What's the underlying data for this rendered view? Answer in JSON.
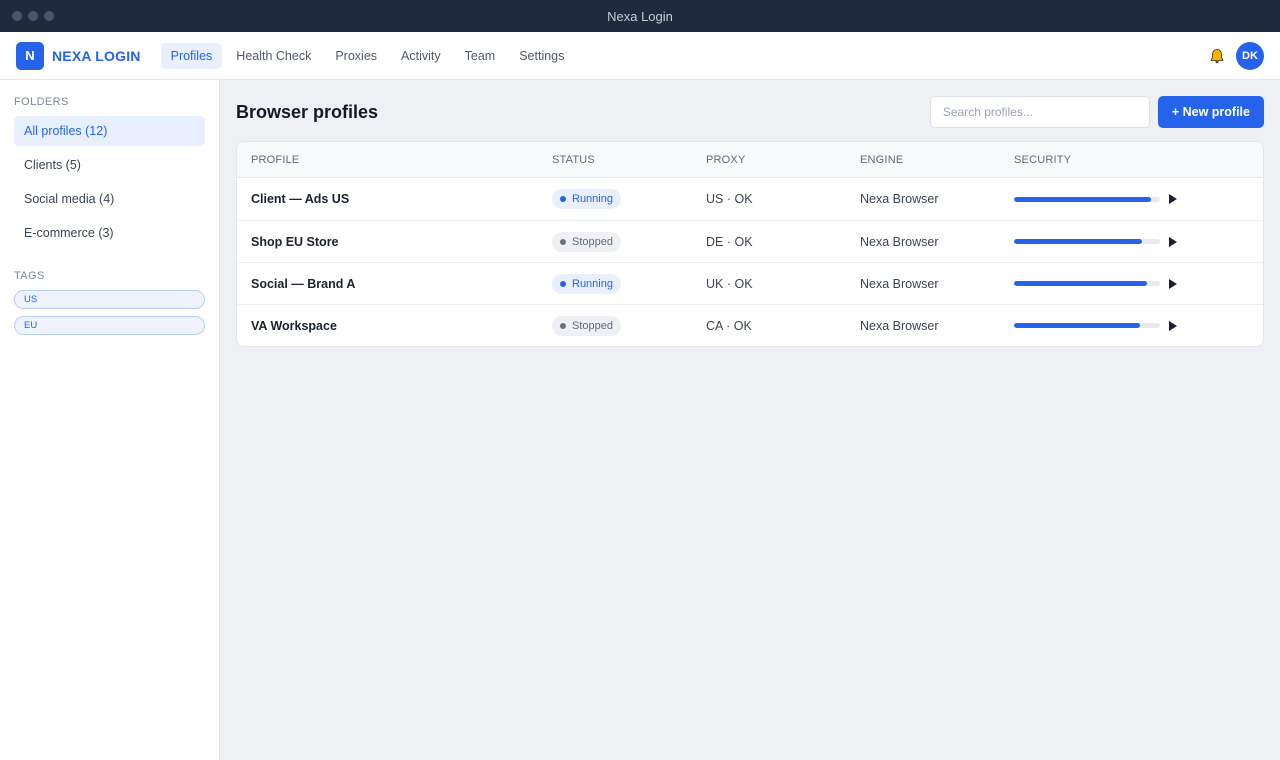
{
  "window": {
    "title": "Nexa Login"
  },
  "brand": {
    "badge": "N",
    "name": "NEXA LOGIN"
  },
  "nav": {
    "tabs": [
      {
        "label": "Profiles",
        "active": true
      },
      {
        "label": "Health Check"
      },
      {
        "label": "Proxies"
      },
      {
        "label": "Activity"
      },
      {
        "label": "Team"
      },
      {
        "label": "Settings"
      }
    ],
    "user_initials": "DK"
  },
  "sidebar": {
    "folders_title": "FOLDERS",
    "folders": [
      {
        "label": "All profiles (12)",
        "active": true
      },
      {
        "label": "Clients (5)"
      },
      {
        "label": "Social media (4)"
      },
      {
        "label": "E-commerce (3)"
      }
    ],
    "tags_title": "TAGS",
    "tags": [
      {
        "label": "US"
      },
      {
        "label": "EU"
      }
    ]
  },
  "main": {
    "title": "Browser profiles",
    "search_placeholder": "Search profiles...",
    "new_button": "+ New profile",
    "columns": [
      "PROFILE",
      "STATUS",
      "PROXY",
      "ENGINE",
      "SECURITY"
    ],
    "rows": [
      {
        "name": "Client — Ads US",
        "status": "Running",
        "proxy": "US · OK",
        "engine": "Nexa Browser",
        "security": 0.94
      },
      {
        "name": "Shop EU Store",
        "status": "Stopped",
        "proxy": "DE · OK",
        "engine": "Nexa Browser",
        "security": 0.88
      },
      {
        "name": "Social — Brand A",
        "status": "Running",
        "proxy": "UK · OK",
        "engine": "Nexa Browser",
        "security": 0.91
      },
      {
        "name": "VA Workspace",
        "status": "Stopped",
        "proxy": "CA · OK",
        "engine": "Nexa Browser",
        "security": 0.86
      }
    ]
  },
  "colors": {
    "accent": "#2563eb",
    "titlebar": "#1e2a3d",
    "background": "#eef0f4",
    "bell": "#f5b400"
  },
  "icons": {
    "notifications": "bell-icon",
    "launch": "play-icon"
  }
}
